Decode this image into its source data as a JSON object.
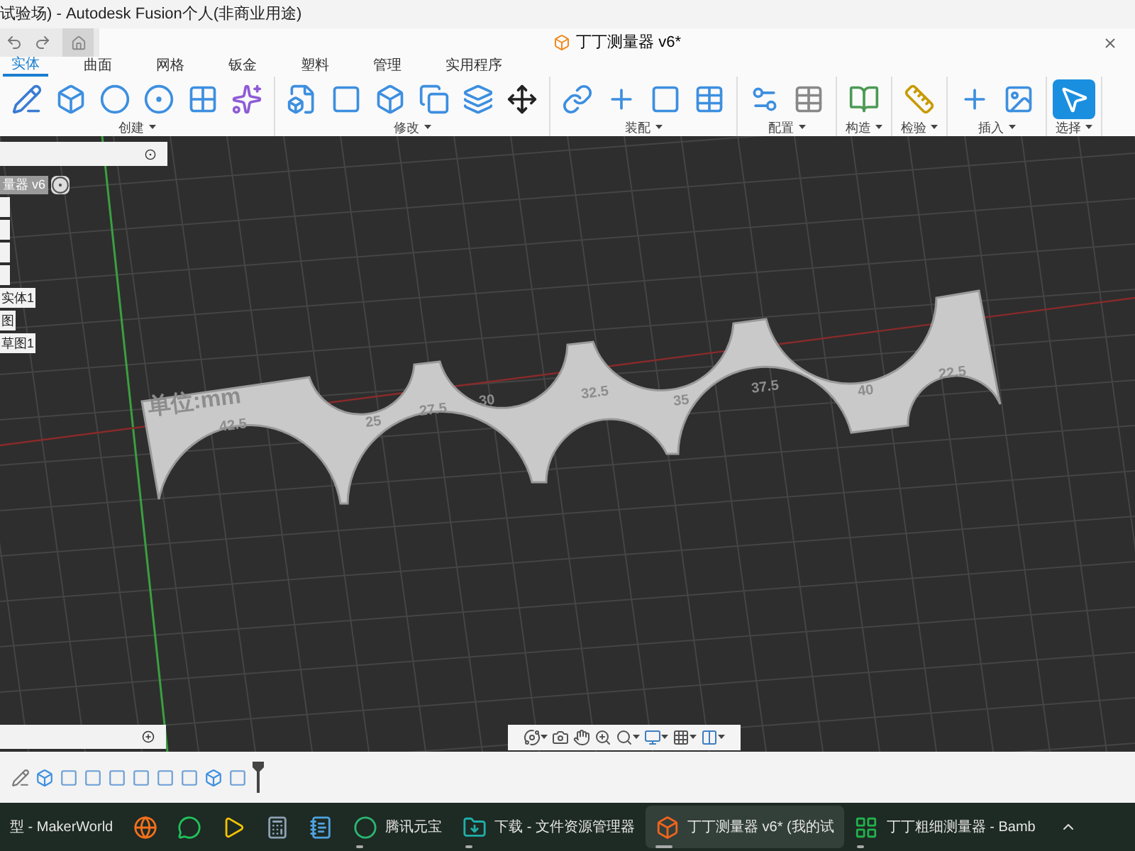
{
  "window": {
    "title": "试验场) - Autodesk Fusion个人(非商业用途)"
  },
  "document_tab": {
    "title": "丁丁测量器 v6*"
  },
  "tabs": [
    {
      "label": "实体",
      "selected": true
    },
    {
      "label": "曲面",
      "selected": false
    },
    {
      "label": "网格",
      "selected": false
    },
    {
      "label": "钣金",
      "selected": false
    },
    {
      "label": "塑料",
      "selected": false
    },
    {
      "label": "管理",
      "selected": false
    },
    {
      "label": "实用程序",
      "selected": false
    }
  ],
  "toolbar_groups": [
    {
      "label": "创建",
      "tools": [
        {
          "kind": "sketch"
        },
        {
          "kind": "extrude"
        },
        {
          "kind": "revolve"
        },
        {
          "kind": "hole"
        },
        {
          "kind": "pattern"
        },
        {
          "kind": "form"
        }
      ]
    },
    {
      "label": "修改",
      "tools": [
        {
          "kind": "presspull"
        },
        {
          "kind": "fillet"
        },
        {
          "kind": "shell"
        },
        {
          "kind": "combine"
        },
        {
          "kind": "split"
        },
        {
          "kind": "move"
        }
      ]
    },
    {
      "label": "装配",
      "tools": [
        {
          "kind": "joint"
        },
        {
          "kind": "component"
        },
        {
          "kind": "rigid"
        },
        {
          "kind": "table"
        }
      ]
    },
    {
      "label": "配置",
      "tools": [
        {
          "kind": "config"
        },
        {
          "kind": "configtable"
        }
      ]
    },
    {
      "label": "构造",
      "tools": [
        {
          "kind": "plane"
        }
      ]
    },
    {
      "label": "检验",
      "tools": [
        {
          "kind": "measure"
        }
      ]
    },
    {
      "label": "插入",
      "tools": [
        {
          "kind": "insert"
        },
        {
          "kind": "image"
        }
      ]
    },
    {
      "label": "选择",
      "tools": [
        {
          "kind": "select",
          "selected": true
        }
      ]
    }
  ],
  "browser": {
    "items": [
      {
        "kind": "root",
        "label": "量器 v6"
      },
      {
        "kind": "clipped"
      },
      {
        "kind": "clipped"
      },
      {
        "kind": "clipped"
      },
      {
        "kind": "clipped"
      },
      {
        "kind": "item",
        "label": "实体1"
      },
      {
        "kind": "item",
        "label": "图"
      },
      {
        "kind": "item",
        "label": "草图1"
      }
    ]
  },
  "model": {
    "labels": [
      "单位:mm",
      "42.5",
      "25",
      "27.5",
      "30",
      "32.5",
      "35",
      "37.5",
      "40",
      "22.5"
    ]
  },
  "nav_tools": [
    {
      "kind": "orbit",
      "menu": true
    },
    {
      "kind": "look"
    },
    {
      "kind": "pan"
    },
    {
      "kind": "zoom"
    },
    {
      "kind": "fit",
      "menu": true
    },
    {
      "kind": "display",
      "menu": true
    },
    {
      "kind": "grid",
      "menu": true
    },
    {
      "kind": "viewports",
      "menu": true
    }
  ],
  "timeline": {
    "features": [
      {
        "kind": "sketch"
      },
      {
        "kind": "extrude"
      },
      {
        "kind": "fillet"
      },
      {
        "kind": "fillet"
      },
      {
        "kind": "fillet"
      },
      {
        "kind": "fillet"
      },
      {
        "kind": "fillet"
      },
      {
        "kind": "fillet"
      },
      {
        "kind": "extrude"
      },
      {
        "kind": "fillet"
      }
    ]
  },
  "taskbar": [
    {
      "kind": "browser-tab",
      "label": "型 - MakerWorld",
      "running": false,
      "selected": false
    },
    {
      "kind": "firefox",
      "running": false,
      "selected": false
    },
    {
      "kind": "wechat",
      "running": false,
      "selected": false
    },
    {
      "kind": "player",
      "running": false,
      "selected": false
    },
    {
      "kind": "calculator",
      "running": false,
      "selected": false
    },
    {
      "kind": "notepad",
      "running": false,
      "selected": false
    },
    {
      "kind": "yuanbao",
      "label": "腾讯元宝",
      "running": true,
      "selected": false
    },
    {
      "kind": "folder",
      "label": "下载 - 文件资源管理器",
      "running": true,
      "selected": false
    },
    {
      "kind": "fusion",
      "label": "丁丁测量器 v6* (我的试",
      "running": true,
      "selected": true
    },
    {
      "kind": "bambu",
      "label": "丁丁粗细测量器 - Bamb",
      "running": true,
      "selected": false
    }
  ]
}
